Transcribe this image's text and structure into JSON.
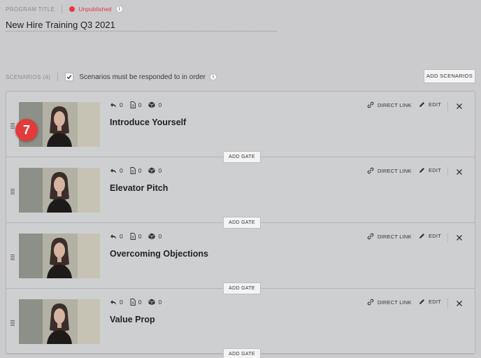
{
  "header": {
    "program_title_label": "PROGRAM TITLE",
    "status": "Unpublished",
    "status_color": "#e63946",
    "title": "New Hire Training Q3 2021"
  },
  "scenarios": {
    "label": "SCENARIOS (4)",
    "order_checkbox_label": "Scenarios must be responded to in order",
    "order_checked": true,
    "add_button": "ADD SCENARIOS"
  },
  "step_badge": "7",
  "cards": [
    {
      "title": "Introduce Yourself",
      "replies": "0",
      "docs": "0",
      "boxes": "0",
      "direct_link": "DIRECT LINK",
      "edit": "EDIT",
      "add_gate": "ADD GATE"
    },
    {
      "title": "Elevator Pitch",
      "replies": "0",
      "docs": "0",
      "boxes": "0",
      "direct_link": "DIRECT LINK",
      "edit": "EDIT",
      "add_gate": "ADD GATE"
    },
    {
      "title": "Overcoming Objections",
      "replies": "0",
      "docs": "0",
      "boxes": "0",
      "direct_link": "DIRECT LINK",
      "edit": "EDIT",
      "add_gate": "ADD GATE"
    },
    {
      "title": "Value Prop",
      "replies": "0",
      "docs": "0",
      "boxes": "0",
      "direct_link": "DIRECT LINK",
      "edit": "EDIT",
      "add_gate": "ADD GATE"
    }
  ]
}
